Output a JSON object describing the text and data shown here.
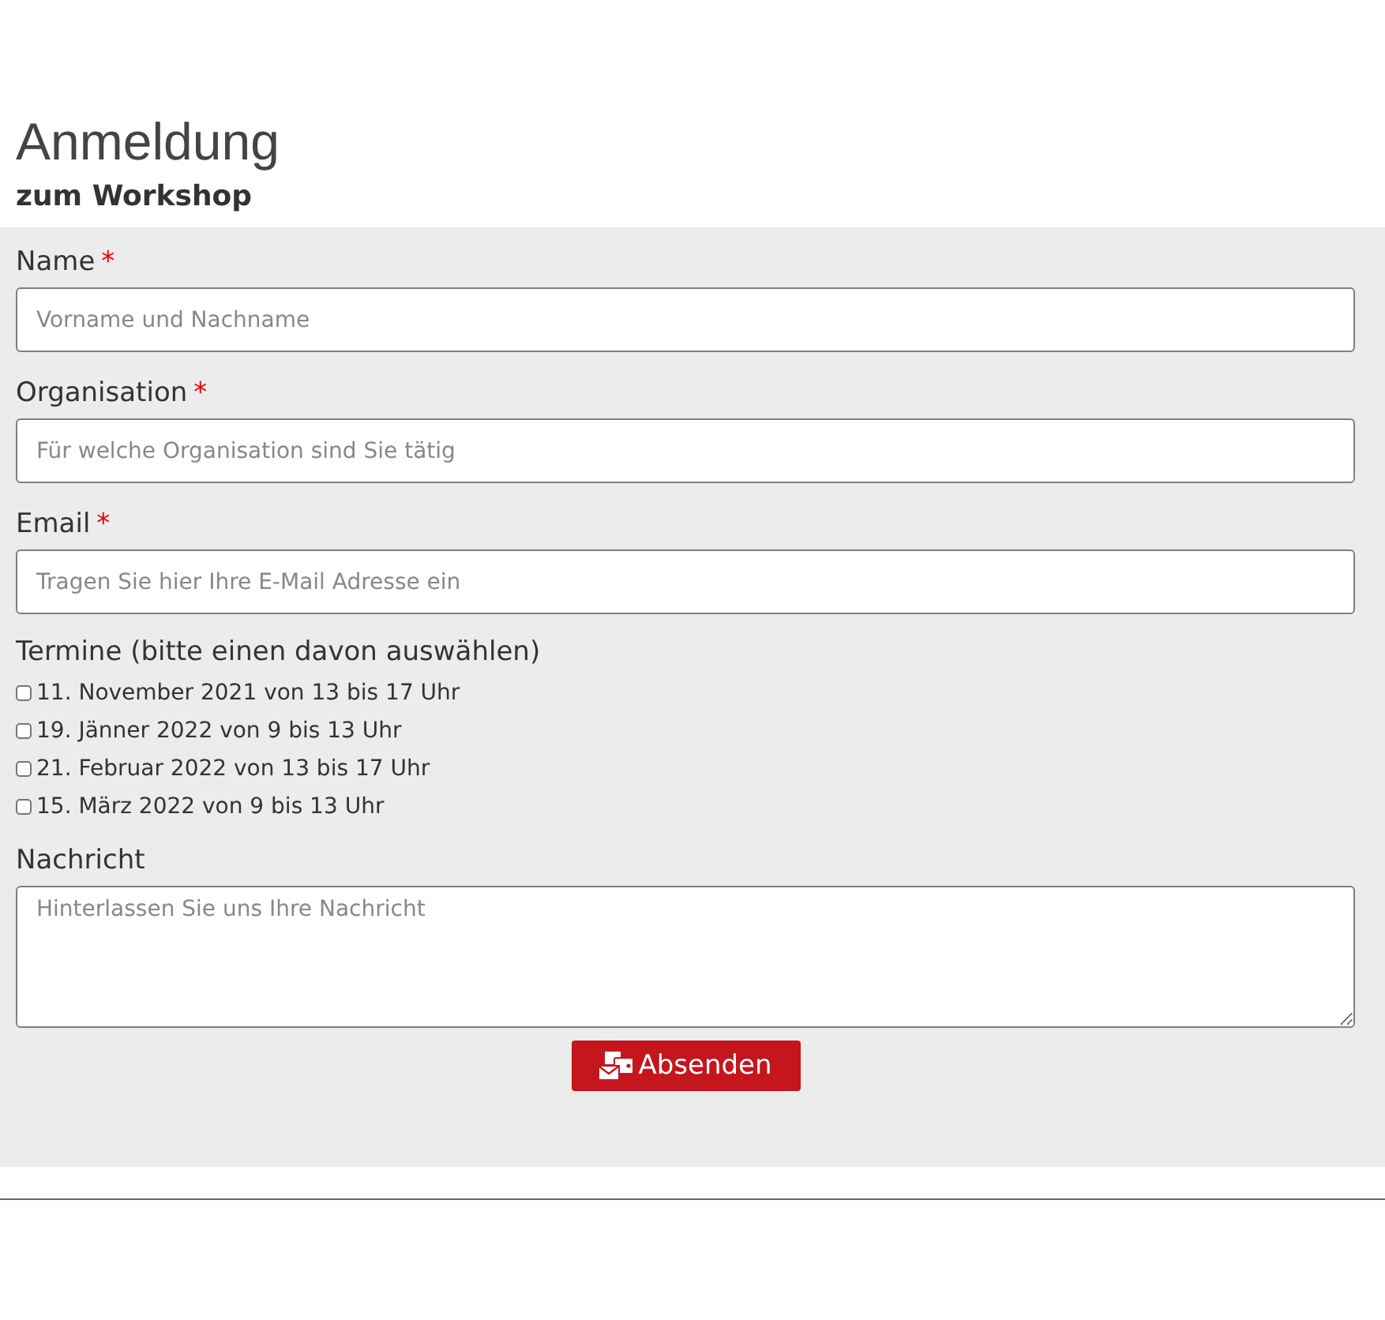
{
  "title": "Anmeldung",
  "subtitle": "zum Workshop",
  "fields": [
    {
      "label": "Name",
      "required_mark": "*",
      "placeholder": "Vorname und Nachname"
    },
    {
      "label": "Organisation",
      "required_mark": "*",
      "placeholder": "Für welche Organisation sind Sie tätig"
    },
    {
      "label": "Email",
      "required_mark": "*",
      "placeholder": "Tragen Sie hier Ihre E-Mail Adresse ein"
    }
  ],
  "dates": {
    "label": "Termine (bitte einen davon auswählen)",
    "options": [
      {
        "label": "11. November 2021 von 13 bis 17 Uhr",
        "checked": false
      },
      {
        "label": "19. Jänner 2022 von 9 bis 13 Uhr",
        "checked": false
      },
      {
        "label": "21. Februar 2022 von 13 bis 17 Uhr",
        "checked": false
      },
      {
        "label": "15. März 2022 von 9 bis 13 Uhr",
        "checked": false
      }
    ]
  },
  "message": {
    "label": "Nachricht",
    "placeholder": "Hinterlassen Sie uns Ihre Nachricht"
  },
  "submit": "Absenden"
}
